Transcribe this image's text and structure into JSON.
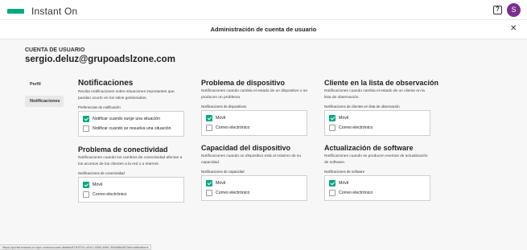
{
  "app": {
    "brand": "Instant On"
  },
  "header": {
    "help_label": "?",
    "avatar_initial": "S"
  },
  "modal": {
    "title": "Administración de cuenta de usuario",
    "close_label": "✕"
  },
  "account": {
    "label": "CUENTA DE USUARIO",
    "email": "sergio.deluz@grupoadslzone.com"
  },
  "nav": {
    "items": [
      {
        "label": "Perfil"
      },
      {
        "label": "Notificaciones"
      }
    ]
  },
  "sections": {
    "notif": {
      "title": "Notificaciones",
      "desc": "Reciba notificaciones sobre situaciones importantes que puedan ocurrir en los sitios gestionados.",
      "label": "Preferencias de notificación",
      "options": [
        {
          "label": "Notificar cuando surge una situación",
          "checked": true
        },
        {
          "label": "Notificar cuando se resuelva una situación",
          "checked": false
        }
      ]
    },
    "conectividad": {
      "title": "Problema de conectividad",
      "desc": "Notificaciones cuando los cambios de conectividad afectan a los accesos de los clientes a la red o a Internet.",
      "label": "Notificaciones de conectividad",
      "options": [
        {
          "label": "Móvil",
          "checked": true
        },
        {
          "label": "Correo electrónico",
          "checked": false
        }
      ]
    },
    "dispositivo": {
      "title": "Problema de dispositivo",
      "desc": "Notificaciones cuando cambia el estado de un dispositivo o se producen un problema.",
      "label": "Notificaciones de dispositivos",
      "options": [
        {
          "label": "Móvil",
          "checked": true
        },
        {
          "label": "Correo electrónico",
          "checked": false
        }
      ]
    },
    "capacidad": {
      "title": "Capacidad del dispositivo",
      "desc": "Notificaciones cuando un dispositivo está al máximo de su capacidad.",
      "label": "Notificaciones de capacidad",
      "options": [
        {
          "label": "Móvil",
          "checked": true
        },
        {
          "label": "Correo electrónico",
          "checked": false
        }
      ]
    },
    "observacion": {
      "title": "Cliente en la lista de observación",
      "desc": "Notificaciones cuando cambia el estado de un cliente en la lista de observación.",
      "label": "Notificaciones de clientes en lista de observación",
      "options": [
        {
          "label": "Móvil",
          "checked": true
        },
        {
          "label": "Correo electrónico",
          "checked": false
        }
      ]
    },
    "software": {
      "title": "Actualización de software",
      "desc": "Notificaciones cuando se producen eventos de actualización de software.",
      "label": "Notificaciones de software",
      "options": [
        {
          "label": "Móvil",
          "checked": true
        },
        {
          "label": "Correo electrónico",
          "checked": false
        }
      ]
    }
  },
  "statusbar": {
    "url": "https://portal.instant-on.hpe.com/account-details/8781f7b1-d2e1-4059-b9f4-30b888c8f23d/notifications"
  },
  "colors": {
    "accent": "#01a982",
    "avatar": "#7b2e8e"
  }
}
